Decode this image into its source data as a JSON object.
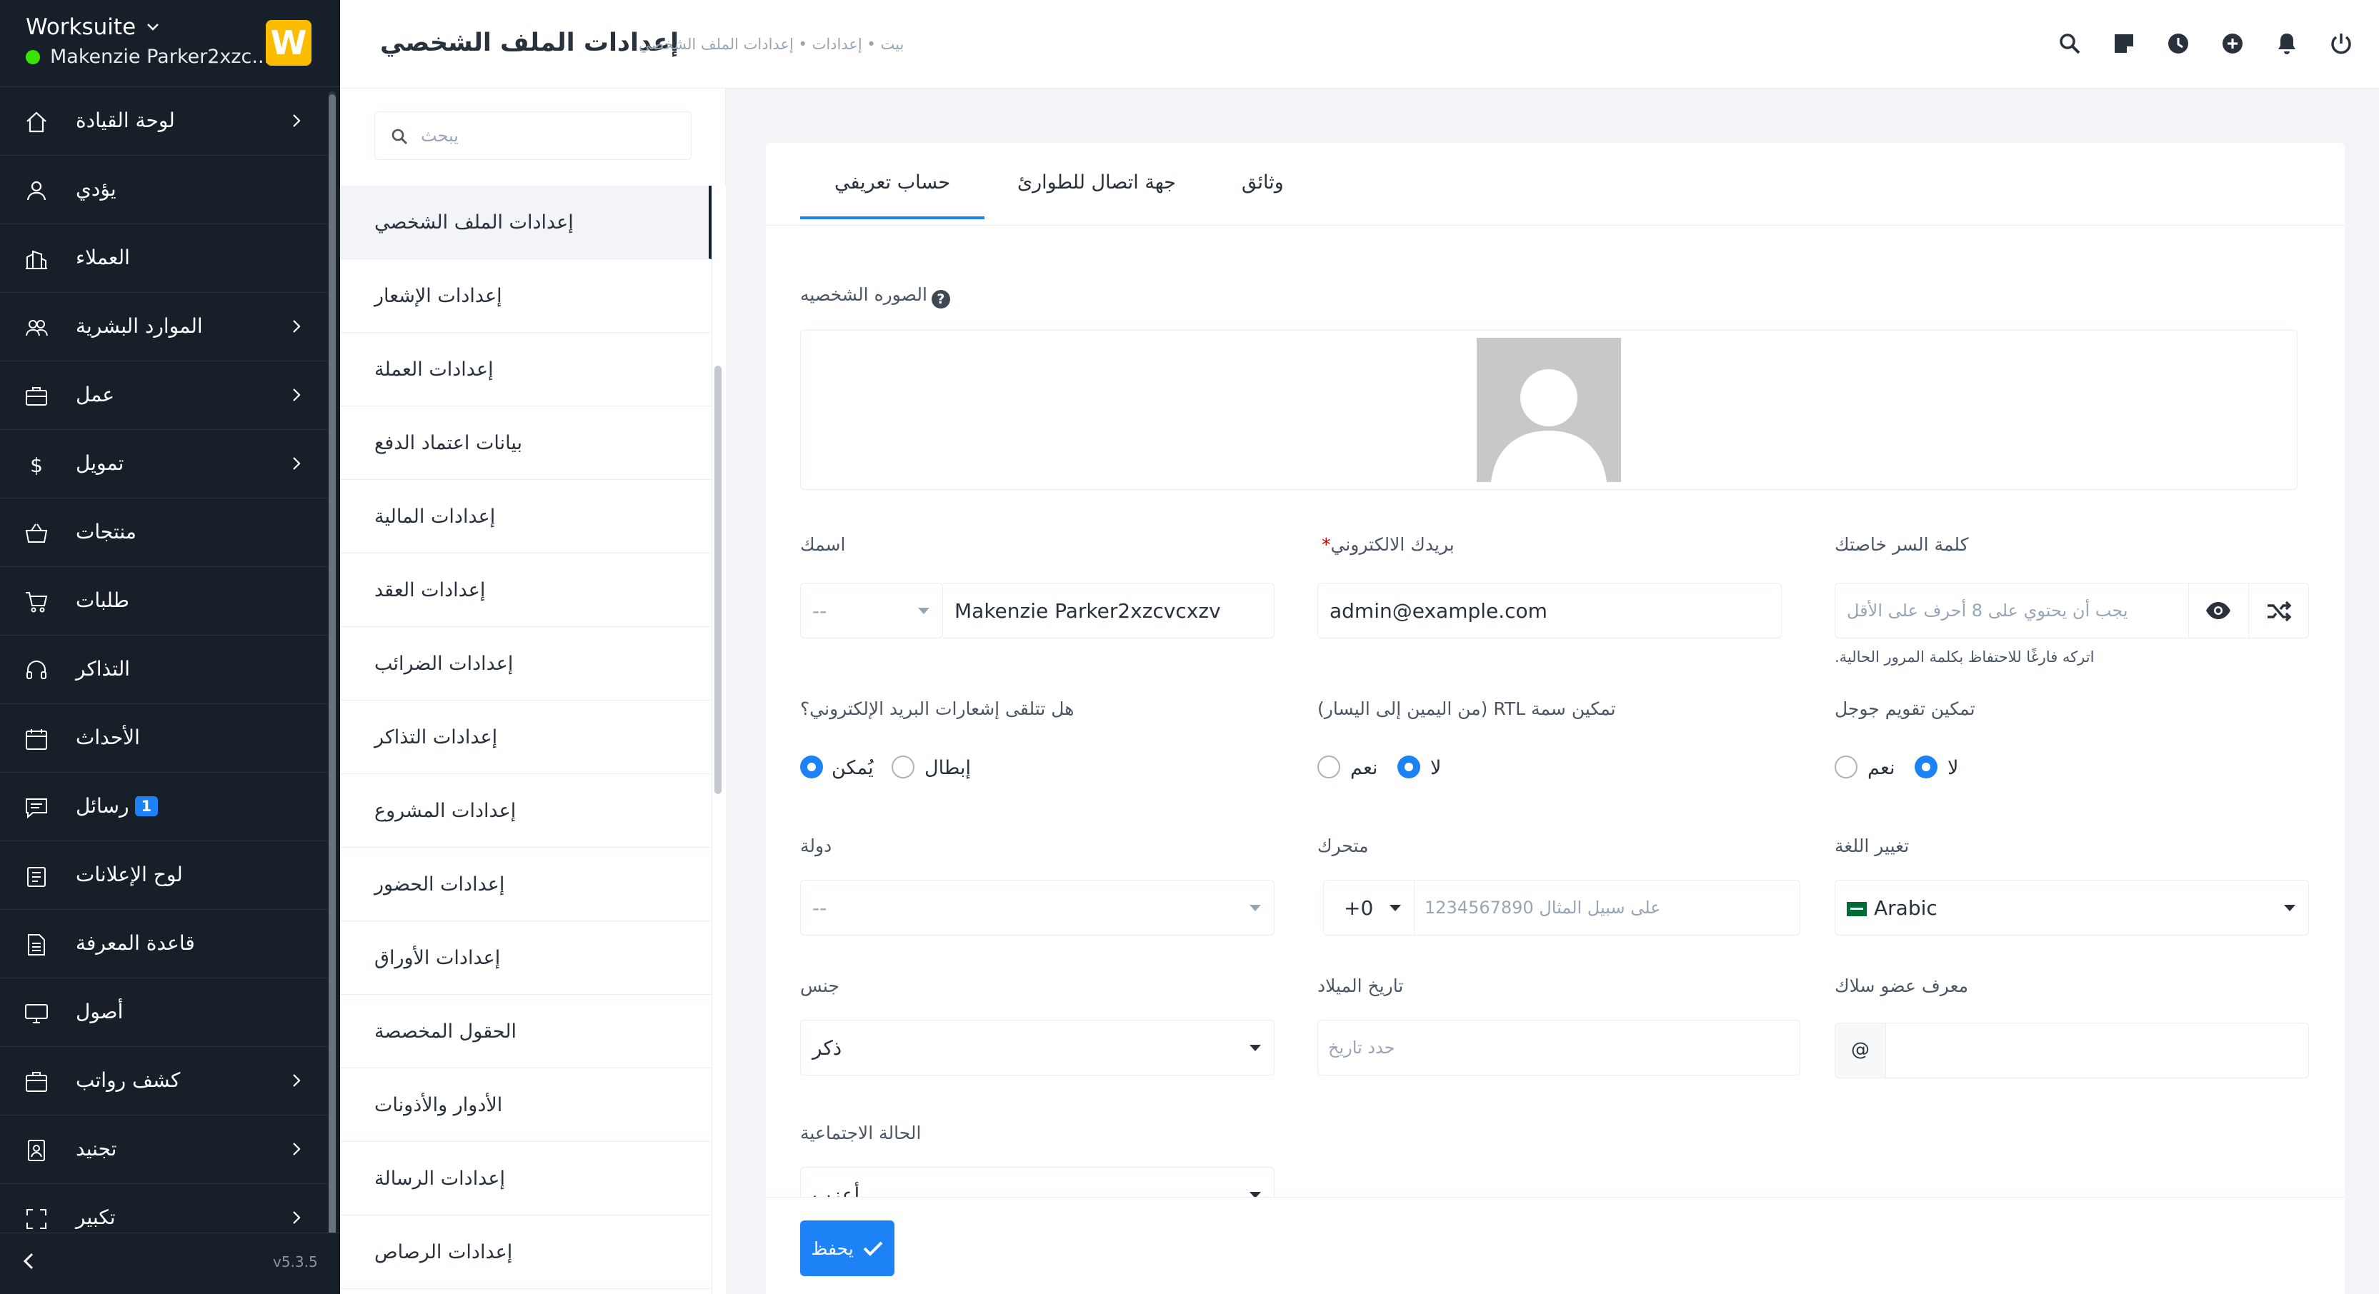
{
  "sidebar": {
    "company": "Worksuite",
    "user_name": "Makenzie Parker2xzc...",
    "logo_letter": "W",
    "version": "v5.3.5",
    "items": [
      {
        "label": "لوحة القيادة",
        "icon": "home-icon",
        "arrow": true
      },
      {
        "label": "يؤدي",
        "icon": "user-icon",
        "arrow": false
      },
      {
        "label": "العملاء",
        "icon": "building-icon",
        "arrow": false
      },
      {
        "label": "الموارد البشرية",
        "icon": "users-icon",
        "arrow": true
      },
      {
        "label": "عمل",
        "icon": "briefcase-icon",
        "arrow": true
      },
      {
        "label": "تمويل",
        "icon": "dollar-icon",
        "arrow": true
      },
      {
        "label": "منتجات",
        "icon": "basket-icon",
        "arrow": false
      },
      {
        "label": "طلبات",
        "icon": "cart-icon",
        "arrow": false
      },
      {
        "label": "التذاكر",
        "icon": "headset-icon",
        "arrow": false
      },
      {
        "label": "الأحداث",
        "icon": "calendar-icon",
        "arrow": false
      },
      {
        "label": "رسائل",
        "icon": "chat-icon",
        "arrow": false,
        "badge": "1"
      },
      {
        "label": "لوح الإعلانات",
        "icon": "clipboard-icon",
        "arrow": false
      },
      {
        "label": "قاعدة المعرفة",
        "icon": "document-icon",
        "arrow": false
      },
      {
        "label": "أصول",
        "icon": "monitor-icon",
        "arrow": false
      },
      {
        "label": "كشف رواتب",
        "icon": "wallet-icon",
        "arrow": true
      },
      {
        "label": "تجنيد",
        "icon": "badge-icon",
        "arrow": true
      },
      {
        "label": "تكبير",
        "icon": "expand-icon",
        "arrow": true
      }
    ]
  },
  "header": {
    "title": "إعدادات الملف الشخصي",
    "breadcrumb": "بيت • إعدادات • إعدادات الملف الشخصي",
    "icons": [
      "search-icon",
      "sticky-note-icon",
      "clock-icon",
      "plus-circle-icon",
      "bell-icon",
      "power-icon"
    ]
  },
  "settings": {
    "search_placeholder": "يبحث",
    "items": [
      "إعدادات الملف الشخصي",
      "إعدادات الإشعار",
      "إعدادات العملة",
      "بيانات اعتماد الدفع",
      "إعدادات المالية",
      "إعدادات العقد",
      "إعدادات الضرائب",
      "إعدادات التذاكر",
      "إعدادات المشروع",
      "إعدادات الحضور",
      "إعدادات الأوراق",
      "الحقول المخصصة",
      "الأدوار والأذونات",
      "إعدادات الرسالة",
      "إعدادات الرصاص"
    ]
  },
  "tabs": [
    "حساب تعريفي",
    "جهة اتصال للطوارئ",
    "وثائق"
  ],
  "form": {
    "photo_label": "الصوره الشخصيه",
    "name_label": "اسمك",
    "name_salutation": "--",
    "name_value": "Makenzie Parker2xzcvcxzv",
    "email_label": "بريدك الالكتروني",
    "email_value": "admin@example.com",
    "password_label": "كلمة السر خاصتك",
    "password_placeholder": "يجب أن يحتوي على 8 أحرف على الأقل",
    "password_hint": "اتركه فارغًا للاحتفاظ بكلمة المرور الحالية.",
    "email_notif_label": "هل تتلقى إشعارات البريد الإلكتروني؟",
    "email_notif_enable": "يُمكن",
    "email_notif_disable": "إبطال",
    "rtl_label": "تمكين سمة RTL (من اليمين إلى اليسار)",
    "rtl_yes": "نعم",
    "rtl_no": "لا",
    "gcal_label": "تمكين تقويم جوجل",
    "gcal_yes": "نعم",
    "gcal_no": "لا",
    "country_label": "دولة",
    "country_value": "--",
    "mobile_label": "متحرك",
    "mobile_code": "+0",
    "mobile_placeholder": "على سبيل المثال 1234567890",
    "language_label": "تغيير اللغة",
    "language_value": "Arabic",
    "gender_label": "جنس",
    "gender_value": "ذكر",
    "dob_label": "تاريخ الميلاد",
    "dob_placeholder": "حدد تاريخ",
    "slack_label": "معرف عضو سلاك",
    "slack_prefix": "@",
    "marital_label": "الحالة الاجتماعية",
    "marital_value": "أعزب",
    "save_label": "يحفظ"
  },
  "colors": {
    "accent": "#1d82f5",
    "sidebar_bg": "#171f29",
    "online": "#39e500",
    "logo": "#fcbd01"
  }
}
